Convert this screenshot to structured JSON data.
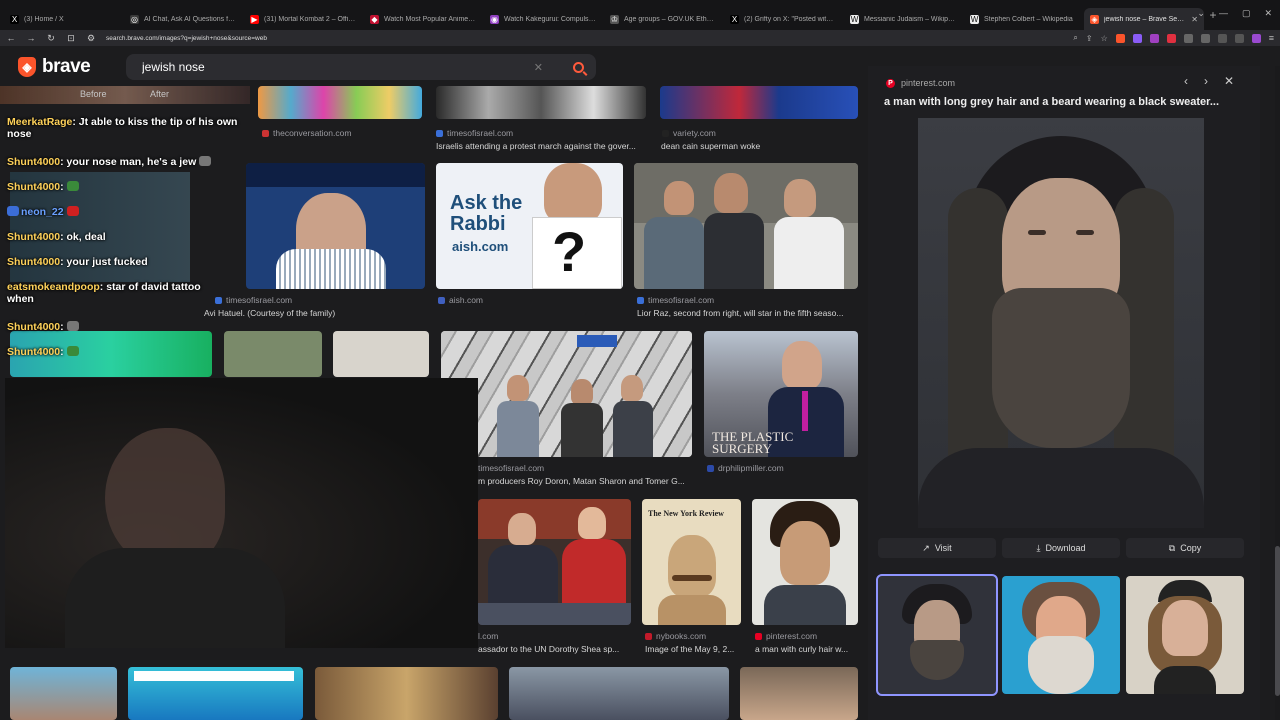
{
  "tabs": [
    {
      "label": "(3) Home / X",
      "icon": "x-logo-icon",
      "color": "#000000",
      "glyph": "X"
    },
    {
      "label": "AI Chat, Ask AI Questions for Expe...",
      "icon": "ai-chat-icon",
      "color": "#3a3a3a",
      "glyph": "◎"
    },
    {
      "label": "(31) Mortal Kombat 2 – Official 'Ur...",
      "icon": "youtube-icon",
      "color": "#ff0000",
      "glyph": "▶"
    },
    {
      "label": "Watch Most Popular Anime SUB/D...",
      "icon": "anime-site-icon",
      "color": "#c01030",
      "glyph": "◆"
    },
    {
      "label": "Watch Kakegurui: Compulsive Gam...",
      "icon": "anime-site-icon",
      "color": "#9040c0",
      "glyph": "◉"
    },
    {
      "label": "Age groups – GOV.UK Ethnicity fac...",
      "icon": "govuk-icon",
      "color": "#555555",
      "glyph": "♔"
    },
    {
      "label": "(2) Grifty on X: \"Posted without an...",
      "icon": "x-logo-icon",
      "color": "#000000",
      "glyph": "X"
    },
    {
      "label": "Messianic Judaism – Wikipedia",
      "icon": "wikipedia-icon",
      "color": "#eeeeee",
      "glyph": "W"
    },
    {
      "label": "Stephen Colbert – Wikipedia",
      "icon": "wikipedia-icon",
      "color": "#eeeeee",
      "glyph": "W"
    },
    {
      "label": "jewish nose – Brave Search",
      "icon": "brave-icon",
      "color": "#fb542b",
      "glyph": "◈"
    }
  ],
  "url": "search.brave.com/images?q=jewish+nose&source=web",
  "brand": "brave",
  "search": {
    "value": "jewish nose"
  },
  "results": {
    "row1": [
      {
        "source": "theconversation.com",
        "desc": ""
      },
      {
        "source": "timesofisrael.com",
        "desc": "Israelis attending a protest march against the gover..."
      },
      {
        "source": "variety.com",
        "desc": "dean cain superman woke"
      }
    ],
    "row2": [
      {
        "source": "timesofisrael.com",
        "desc": "Avi Hatuel. (Courtesy of the family)"
      },
      {
        "source": "aish.com",
        "desc": ""
      },
      {
        "source": "timesofisrael.com",
        "desc": "Lior Raz, second from right, will star in the fifth seaso..."
      }
    ],
    "ask_rabbi": {
      "line1": "Ask the",
      "line2": "Rabbi",
      "line3": "aish.com"
    },
    "row3": [
      {
        "source": "timesofisrael.com",
        "desc": "m producers Roy Doron, Matan Sharon and Tomer G..."
      },
      {
        "source": "drphilipmiller.com",
        "desc": ""
      }
    ],
    "plastic_surgery": "THE PLASTIC SURGERY",
    "row4": [
      {
        "source": "l.com",
        "desc": "assador to the UN Dorothy Shea sp..."
      },
      {
        "source": "nybooks.com",
        "desc": "Image of the May 9, 2..."
      },
      {
        "source": "pinterest.com",
        "desc": "a man with curly hair w..."
      }
    ],
    "nyreview": "The New York Review",
    "before_after": {
      "before": "Before",
      "after": "After"
    }
  },
  "preview": {
    "source": "pinterest.com",
    "title": "a man with long grey hair and a beard wearing a black sweater...",
    "visit": "Visit",
    "download": "Download",
    "copy": "Copy"
  },
  "chat": [
    {
      "user": "",
      "text": ""
    },
    {
      "user": "MeerkatRage",
      "text": ": Jt able to kiss the tip of his own",
      "text2": "nose"
    },
    {
      "user": "Shunt4000",
      "text": ": your nose man, he's a jew"
    },
    {
      "user": "Shunt4000",
      "text": ":"
    },
    {
      "user": "neon_22",
      "text": ""
    },
    {
      "user": "Shunt4000",
      "text": ": ok, deal"
    },
    {
      "user": "Shunt4000",
      "text": ": your just fucked"
    },
    {
      "user": "eatsmokeandpoop",
      "text": ": star of david tattoo",
      "text2": "when"
    },
    {
      "user": "Shunt4000",
      "text": ":"
    },
    {
      "user": "Shunt4000",
      "text": ":"
    }
  ],
  "colors": {
    "accent": "#fb542b",
    "selected_outline": "#8f95ff",
    "username": "#ffd25a"
  }
}
